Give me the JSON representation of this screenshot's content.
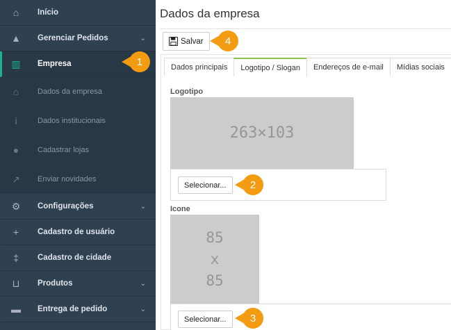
{
  "sidebar": {
    "items": [
      {
        "label": "Início",
        "icon": "home-icon",
        "glyph": "⌂"
      },
      {
        "label": "Gerenciar Pedidos",
        "icon": "warning-icon",
        "glyph": "▲",
        "chevron": "⌄"
      },
      {
        "label": "Empresa",
        "icon": "building-icon",
        "glyph": "▥"
      },
      {
        "label": "Dados da empresa",
        "icon": "bank-icon",
        "glyph": "⌂"
      },
      {
        "label": "Dados institucionais",
        "icon": "info-icon",
        "glyph": "i"
      },
      {
        "label": "Cadastrar lojas",
        "icon": "map-marker-icon",
        "glyph": "●"
      },
      {
        "label": "Enviar novidades",
        "icon": "external-link-icon",
        "glyph": "↗"
      },
      {
        "label": "Configurações",
        "icon": "cogs-icon",
        "glyph": "⚙",
        "chevron": "⌄"
      },
      {
        "label": "Cadastro de usuário",
        "icon": "user-plus-icon",
        "glyph": "+"
      },
      {
        "label": "Cadastro de cidade",
        "icon": "signpost-icon",
        "glyph": "‡"
      },
      {
        "label": "Produtos",
        "icon": "cart-icon",
        "glyph": "⊔",
        "chevron": "⌄"
      },
      {
        "label": "Entrega de pedido",
        "icon": "truck-icon",
        "glyph": "▬",
        "chevron": "⌄"
      }
    ]
  },
  "page": {
    "title": "Dados da empresa"
  },
  "toolbar": {
    "save_label": "Salvar"
  },
  "tabs": [
    "Dados principais",
    "Logotipo / Slogan",
    "Endereços de e-mail",
    "Mídias sociais"
  ],
  "logo": {
    "label": "Logotipo",
    "placeholder": "263×103",
    "button": "Selecionar..."
  },
  "icon_section": {
    "label": "Icone",
    "placeholder_lines": [
      "85",
      "x",
      "85"
    ],
    "button": "Selecionar..."
  },
  "callouts": [
    "1",
    "2",
    "3",
    "4"
  ],
  "colors": {
    "sidebar_bg": "#2f4050",
    "accent": "#1ab394",
    "tab_active": "#8cc152",
    "callout": "#f39c12",
    "placeholder_bg": "#cccccc"
  }
}
